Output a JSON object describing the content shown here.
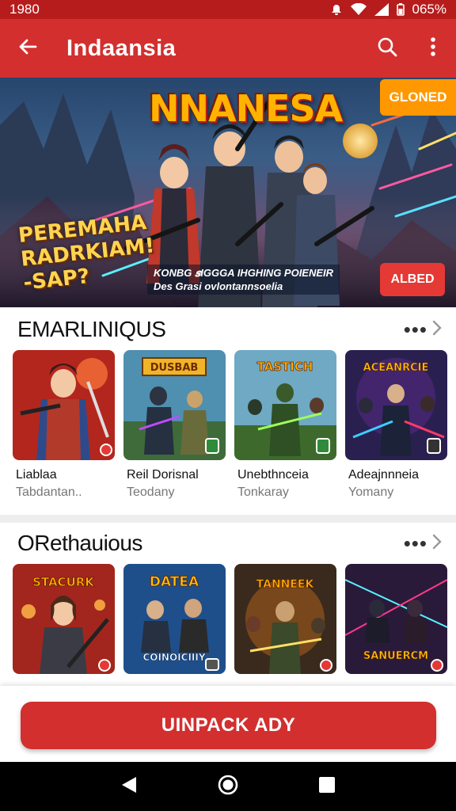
{
  "status_bar": {
    "time": "1980",
    "battery": "065%"
  },
  "app_bar": {
    "title": "Indaansia"
  },
  "hero": {
    "title": "NNANESA",
    "slogan": "PEREMAHA RADRKIAM! -SAP?",
    "caption_line1": "KONBG 𝒔IGGGA IHGHING POIENEIR",
    "caption_line2": "Des Grasi ovlontannsoelia",
    "badge_top": "GLONED",
    "badge_bottom": "ALBED"
  },
  "sections": [
    {
      "title": "EMARLINIQUS",
      "cards": [
        {
          "name": "Liablaa",
          "sub": "Tabdantan..",
          "banner": ""
        },
        {
          "name": "Reil Dorisnal",
          "sub": "Teodany",
          "banner": "DUSBAB"
        },
        {
          "name": "Unebthnceia",
          "sub": "Tonkaray",
          "banner": "TASTICH"
        },
        {
          "name": "Adeajnnneia",
          "sub": "Yomany",
          "banner": "ACEANRCIE"
        }
      ]
    },
    {
      "title": "ORethauious",
      "cards": [
        {
          "name": "",
          "sub": "",
          "banner": "STACURK"
        },
        {
          "name": "",
          "sub": "",
          "banner": "DATEA"
        },
        {
          "name": "",
          "sub": "",
          "banner": "TANNEEK"
        },
        {
          "name": "",
          "sub": "",
          "banner": "SANUERCM"
        }
      ]
    }
  ],
  "card_extra": {
    "card2_bottom": "COINOICIIIY"
  },
  "primary_button": {
    "label": "UINPACK ADY"
  },
  "colors": {
    "primary": "#d32f2f",
    "primary_dark": "#b71c1c",
    "badge_orange": "#ff9800"
  },
  "icons": [
    "back-arrow-icon",
    "search-icon",
    "overflow-menu-icon",
    "chevron-right-icon",
    "nav-back-icon",
    "nav-home-icon",
    "nav-recents-icon"
  ]
}
